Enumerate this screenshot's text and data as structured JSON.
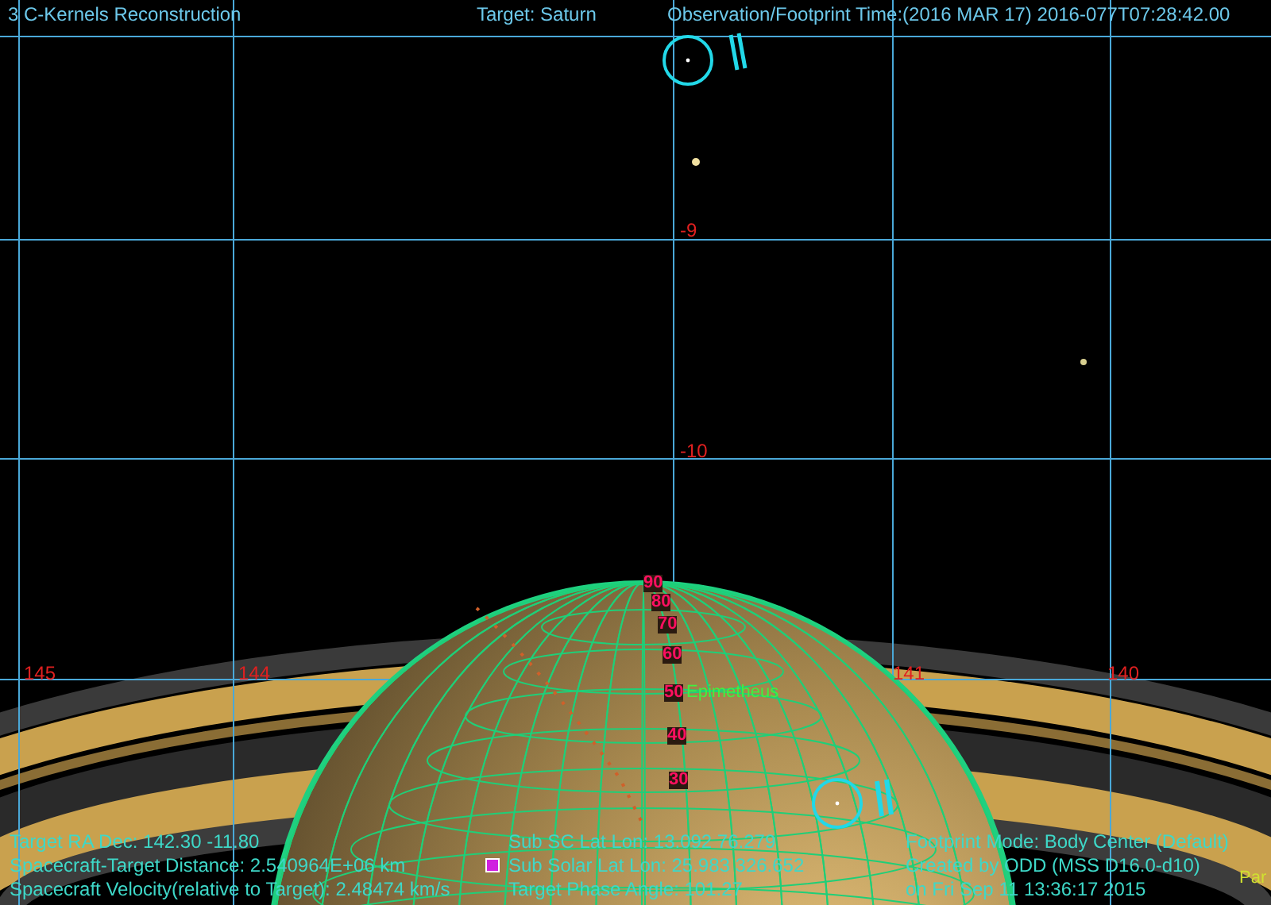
{
  "header": {
    "title": "3  C-Kernels Reconstruction",
    "target": "Target: Saturn",
    "observation_time": "Observation/Footprint Time:(2016 MAR 17) 2016-077T07:28:42.00"
  },
  "grid": {
    "dec_labels": [
      "-9",
      "-10"
    ],
    "ra_labels": [
      "145",
      "144",
      "141",
      "140"
    ]
  },
  "planet": {
    "latitude_labels": [
      "90",
      "80",
      "70",
      "60",
      "50",
      "40",
      "30"
    ],
    "moon_label": "Epimetheus"
  },
  "info_left": [
    "Target RA Dec: 142.30  -11.80",
    "Spacecraft-Target Distance: 2.540964E+06 km",
    "Spacecraft Velocity(relative to Target): 2.48474 km/s"
  ],
  "info_center": [
    "Sub SC Lat Lon: 13.092  76.279",
    "Sub Solar Lat Lon: 25.983  326.652",
    "Target Phase Angle: 101.27"
  ],
  "info_right": [
    "Footprint Mode: Body Center (Default)",
    "Created by ODD (MSS D16.0-d10)",
    "on Fri Sep 11 13:36:17 2015"
  ],
  "edge_label": "Par"
}
